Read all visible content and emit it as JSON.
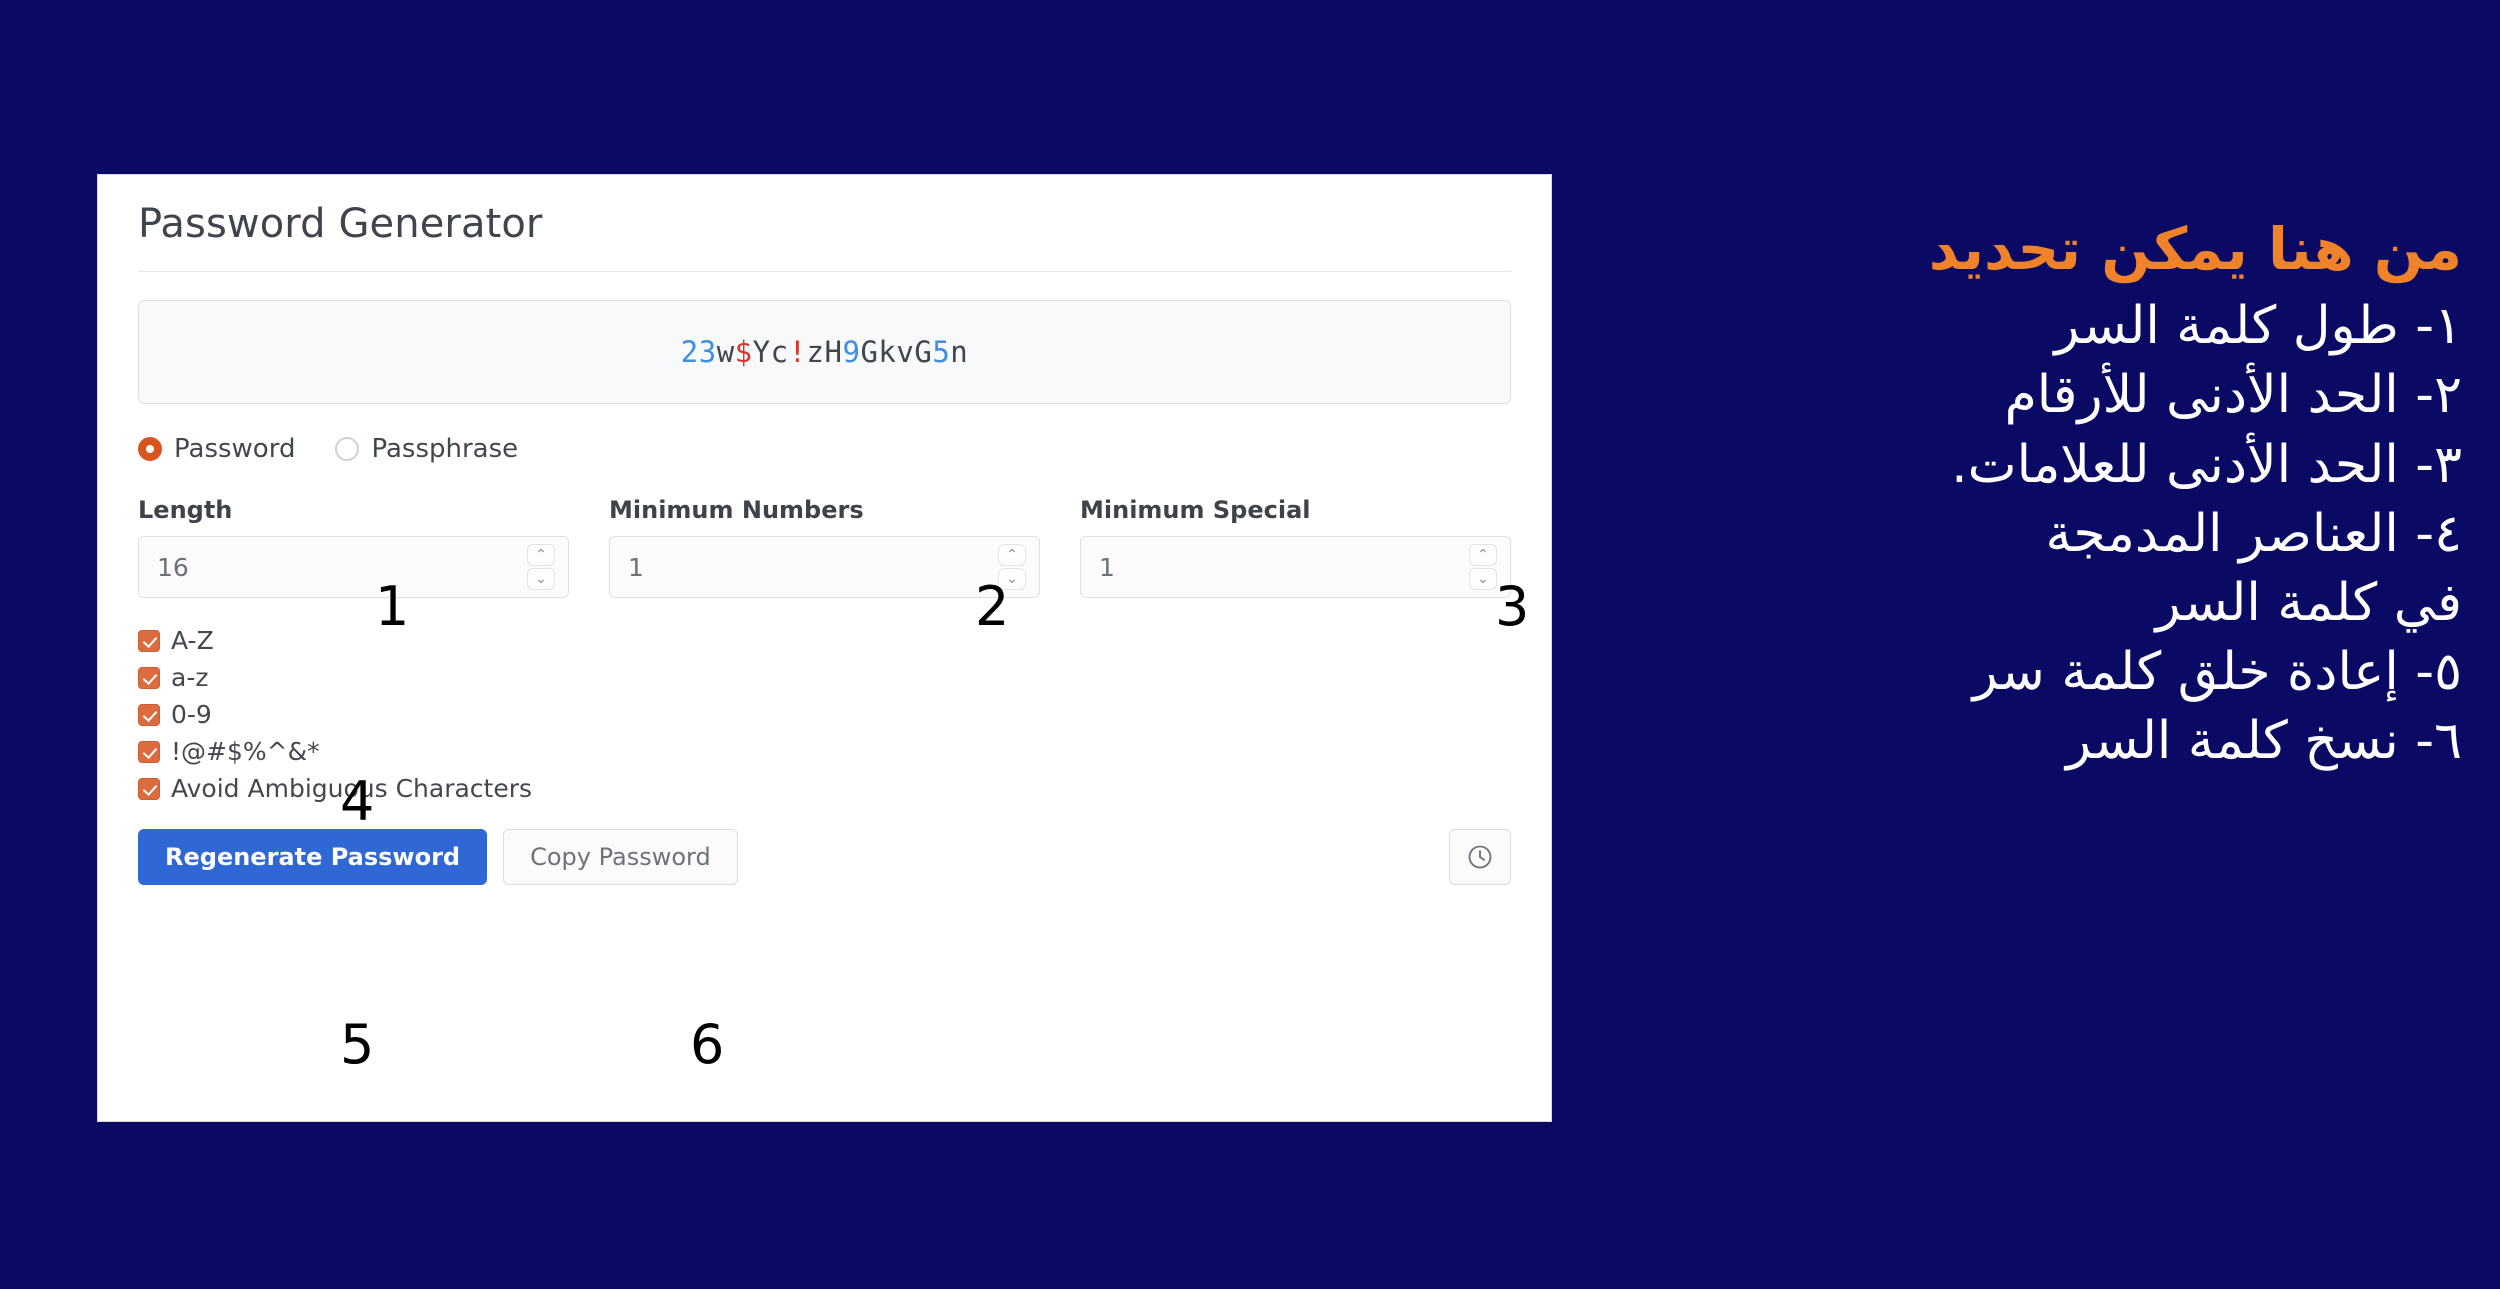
{
  "theme": {
    "background": "#0a0a64",
    "card_background": "#ffffff",
    "primary_button": "#2f68d4",
    "accent_orange": "#dc6b3f",
    "radio_selected": "#d9541e",
    "heading_orange": "#f0832a",
    "digit_color": "#3d8fe0",
    "special_color": "#d9342b",
    "letter_color": "#41464d"
  },
  "card": {
    "title": "Password Generator",
    "password_display": {
      "value": "23w$Yc!zH9GkvG5n",
      "chars": [
        {
          "c": "2",
          "kind": "digit"
        },
        {
          "c": "3",
          "kind": "digit"
        },
        {
          "c": "w",
          "kind": "letter"
        },
        {
          "c": "$",
          "kind": "special"
        },
        {
          "c": "Y",
          "kind": "letter"
        },
        {
          "c": "c",
          "kind": "letter"
        },
        {
          "c": "!",
          "kind": "special"
        },
        {
          "c": "z",
          "kind": "letter"
        },
        {
          "c": "H",
          "kind": "letter"
        },
        {
          "c": "9",
          "kind": "digit"
        },
        {
          "c": "G",
          "kind": "letter"
        },
        {
          "c": "k",
          "kind": "letter"
        },
        {
          "c": "v",
          "kind": "letter"
        },
        {
          "c": "G",
          "kind": "letter"
        },
        {
          "c": "5",
          "kind": "digit"
        },
        {
          "c": "n",
          "kind": "letter"
        }
      ]
    },
    "type_options": [
      {
        "label": "Password",
        "selected": true
      },
      {
        "label": "Passphrase",
        "selected": false
      }
    ],
    "fields": [
      {
        "label": "Length",
        "value": "16",
        "annotation": "1"
      },
      {
        "label": "Minimum Numbers",
        "value": "1",
        "annotation": "2"
      },
      {
        "label": "Minimum Special",
        "value": "1",
        "annotation": "3"
      }
    ],
    "spinner": {
      "up": "⌃",
      "down": "⌄"
    },
    "checkboxes": [
      {
        "label": "A-Z",
        "checked": true
      },
      {
        "label": "a-z",
        "checked": true
      },
      {
        "label": "0-9",
        "checked": true
      },
      {
        "label": "!@#$%^&*",
        "checked": true
      },
      {
        "label": "Avoid Ambiguous Characters",
        "checked": true
      }
    ],
    "checkbox_annotation": "4",
    "buttons": {
      "regenerate": "Regenerate Password",
      "regenerate_annotation": "5",
      "copy": "Copy Password",
      "copy_annotation": "6",
      "history_icon": "clock-history-icon"
    }
  },
  "annotations": {
    "heading": "من هنا يمكن تحديد",
    "lines": [
      "١- طول كلمة السر",
      "٢- الحد الأدنى للأرقام",
      "٣- الحد الأدنى للعلامات.",
      "٤- العناصر المدمجة",
      "في كلمة السر",
      "٥- إعادة خلق كلمة سر",
      "٦- نسخ كلمة السر"
    ]
  }
}
